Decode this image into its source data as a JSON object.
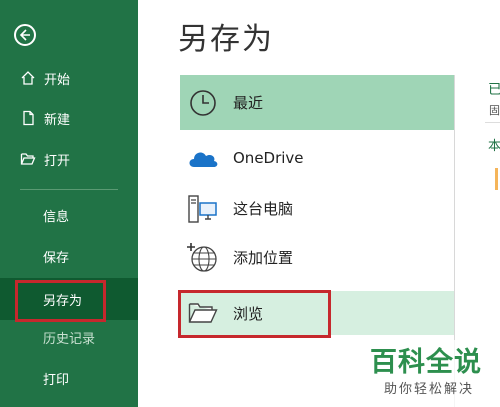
{
  "sidebar": {
    "items": [
      {
        "label": "开始",
        "icon": "home-icon"
      },
      {
        "label": "新建",
        "icon": "new-document-icon"
      },
      {
        "label": "打开",
        "icon": "open-folder-icon"
      },
      {
        "label": "信息"
      },
      {
        "label": "保存"
      },
      {
        "label": "另存为",
        "active": true
      },
      {
        "label": "历史记录"
      },
      {
        "label": "打印"
      }
    ],
    "back_icon": "back-arrow-icon",
    "accent_color": "#217346",
    "active_color": "#0f5a30"
  },
  "main": {
    "title": "另存为",
    "places": [
      {
        "label": "最近",
        "icon": "clock-icon",
        "selected": true
      },
      {
        "label": "OneDrive",
        "icon": "cloud-icon"
      },
      {
        "label": "这台电脑",
        "icon": "computer-icon"
      },
      {
        "label": "添加位置",
        "icon": "globe-plus-icon"
      },
      {
        "label": "浏览",
        "icon": "folder-icon"
      }
    ],
    "selected_color": "#9fd5b6"
  },
  "right_column": {
    "heading": "已",
    "subtext": "固",
    "section": "本"
  },
  "watermark": {
    "title": "百科全说",
    "subtitle": "助你轻松解决"
  },
  "annotation_color": "#c6282d"
}
